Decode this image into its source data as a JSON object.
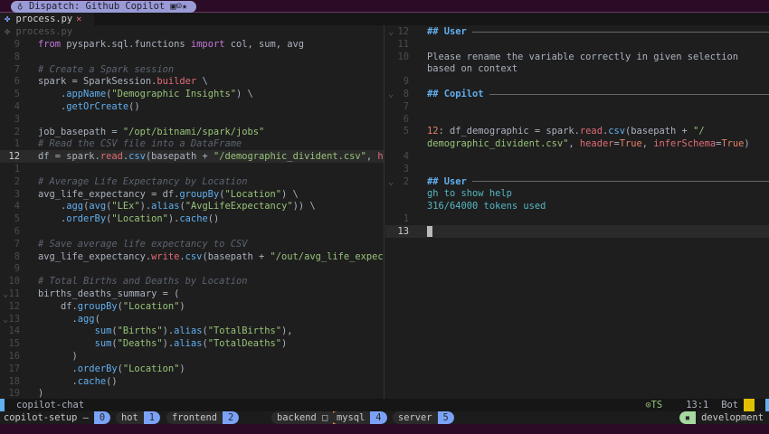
{
  "title_bar": {
    "title": "Dispatch: Github Copilot",
    "icons": [
      "tux-icon",
      "emoji-icons"
    ]
  },
  "tab": {
    "label": "process.py",
    "close": "✕"
  },
  "left_pane": {
    "winbar": "process.py",
    "lines": [
      {
        "n": "9",
        "t": [
          [
            "from ",
            "kw"
          ],
          [
            "pyspark.sql.functions ",
            ""
          ],
          [
            "import ",
            "kw"
          ],
          [
            "col, sum, avg",
            ""
          ]
        ]
      },
      {
        "n": "8",
        "t": []
      },
      {
        "n": "7",
        "t": [
          [
            "# Create a Spark session",
            "cm"
          ]
        ]
      },
      {
        "n": "6",
        "t": [
          [
            "spark = ",
            ""
          ],
          [
            "SparkSession",
            ""
          ],
          [
            ".",
            ""
          ],
          [
            "builder",
            "rd"
          ],
          [
            " \\",
            ""
          ]
        ]
      },
      {
        "n": "5",
        "t": [
          [
            "    .",
            ""
          ],
          [
            "appName",
            "fn"
          ],
          [
            "(",
            ""
          ],
          [
            "\"Demographic Insights\"",
            "st"
          ],
          [
            ") \\",
            ""
          ]
        ]
      },
      {
        "n": "4",
        "t": [
          [
            "    .",
            ""
          ],
          [
            "getOrCreate",
            "fn"
          ],
          [
            "()",
            ""
          ]
        ]
      },
      {
        "n": "3",
        "t": []
      },
      {
        "n": "2",
        "t": [
          [
            "job_basepath = ",
            ""
          ],
          [
            "\"/opt/bitnami/spark/jobs\"",
            "st"
          ]
        ]
      },
      {
        "n": "1",
        "t": [
          [
            "# Read the CSV file into a DataFrame",
            "cm"
          ]
        ]
      },
      {
        "n": "12",
        "cur": true,
        "t": [
          [
            "df = spark.",
            ""
          ],
          [
            "read",
            "rd"
          ],
          [
            ".",
            ""
          ],
          [
            "csv",
            "fn"
          ],
          [
            "(basepath + ",
            ""
          ],
          [
            "\"/demographic_divident.csv\"",
            "st"
          ],
          [
            ", ",
            ""
          ],
          [
            "h",
            "rd"
          ]
        ]
      },
      {
        "n": "1",
        "t": []
      },
      {
        "n": "2",
        "t": [
          [
            "# Average Life Expectancy by Location",
            "cm"
          ]
        ]
      },
      {
        "n": "3",
        "t": [
          [
            "avg_life_expectancy = df.",
            ""
          ],
          [
            "groupBy",
            "fn"
          ],
          [
            "(",
            ""
          ],
          [
            "\"Location\"",
            "st"
          ],
          [
            ") \\",
            ""
          ]
        ]
      },
      {
        "n": "4",
        "t": [
          [
            "    .",
            ""
          ],
          [
            "agg",
            "fn"
          ],
          [
            "(",
            ""
          ],
          [
            "avg",
            "fn"
          ],
          [
            "(",
            ""
          ],
          [
            "\"LEx\"",
            "st"
          ],
          [
            ").",
            ""
          ],
          [
            "alias",
            "fn"
          ],
          [
            "(",
            ""
          ],
          [
            "\"AvgLifeExpectancy\"",
            "st"
          ],
          [
            ")) \\",
            ""
          ]
        ]
      },
      {
        "n": "5",
        "t": [
          [
            "    .",
            ""
          ],
          [
            "orderBy",
            "fn"
          ],
          [
            "(",
            ""
          ],
          [
            "\"Location\"",
            "st"
          ],
          [
            ").",
            ""
          ],
          [
            "cache",
            "fn"
          ],
          [
            "()",
            ""
          ]
        ]
      },
      {
        "n": "6",
        "t": []
      },
      {
        "n": "7",
        "t": [
          [
            "# Save average life expectancy to CSV",
            "cm"
          ]
        ]
      },
      {
        "n": "8",
        "t": [
          [
            "avg_life_expectancy.",
            ""
          ],
          [
            "write",
            "rd"
          ],
          [
            ".",
            ""
          ],
          [
            "csv",
            "fn"
          ],
          [
            "(basepath + ",
            ""
          ],
          [
            "\"/out/avg_life_expec",
            "st"
          ]
        ]
      },
      {
        "n": "9",
        "t": []
      },
      {
        "n": "10",
        "t": [
          [
            "# Total Births and Deaths by Location",
            "cm"
          ]
        ]
      },
      {
        "n": "11",
        "fold": true,
        "t": [
          [
            "births_deaths_summary = (",
            ""
          ]
        ]
      },
      {
        "n": "12",
        "t": [
          [
            "    df.",
            ""
          ],
          [
            "groupBy",
            "fn"
          ],
          [
            "(",
            ""
          ],
          [
            "\"Location\"",
            "st"
          ],
          [
            ")",
            ""
          ]
        ]
      },
      {
        "n": "13",
        "fold": true,
        "t": [
          [
            "      .",
            ""
          ],
          [
            "agg",
            "fn"
          ],
          [
            "(",
            ""
          ]
        ]
      },
      {
        "n": "14",
        "t": [
          [
            "          ",
            ""
          ],
          [
            "sum",
            "fn"
          ],
          [
            "(",
            ""
          ],
          [
            "\"Births\"",
            "st"
          ],
          [
            ").",
            ""
          ],
          [
            "alias",
            "fn"
          ],
          [
            "(",
            ""
          ],
          [
            "\"TotalBirths\"",
            "st"
          ],
          [
            "),",
            ""
          ]
        ]
      },
      {
        "n": "15",
        "t": [
          [
            "          ",
            ""
          ],
          [
            "sum",
            "fn"
          ],
          [
            "(",
            ""
          ],
          [
            "\"Deaths\"",
            "st"
          ],
          [
            ").",
            ""
          ],
          [
            "alias",
            "fn"
          ],
          [
            "(",
            ""
          ],
          [
            "\"TotalDeaths\"",
            "st"
          ],
          [
            ")",
            ""
          ]
        ]
      },
      {
        "n": "16",
        "t": [
          [
            "      )",
            ""
          ]
        ]
      },
      {
        "n": "17",
        "t": [
          [
            "      .",
            ""
          ],
          [
            "orderBy",
            "fn"
          ],
          [
            "(",
            ""
          ],
          [
            "\"Location\"",
            "st"
          ],
          [
            ")",
            ""
          ]
        ]
      },
      {
        "n": "18",
        "t": [
          [
            "      .",
            ""
          ],
          [
            "cache",
            "fn"
          ],
          [
            "()",
            ""
          ]
        ]
      },
      {
        "n": "19",
        "t": [
          [
            ")",
            ""
          ]
        ]
      }
    ]
  },
  "right_pane": {
    "lines": [
      {
        "n": "12",
        "fold": true,
        "rule": true,
        "t": [
          [
            "## User",
            "hd"
          ]
        ]
      },
      {
        "n": "11",
        "t": []
      },
      {
        "n": "10",
        "t": [
          [
            "Please rename the variable correctly in given selection",
            ""
          ]
        ]
      },
      {
        "n": "",
        "t": [
          [
            "based on context",
            ""
          ]
        ]
      },
      {
        "n": "9",
        "t": []
      },
      {
        "n": "8",
        "fold": true,
        "rule": true,
        "t": [
          [
            "## Copilot",
            "hd"
          ]
        ]
      },
      {
        "n": "7",
        "t": []
      },
      {
        "n": "6",
        "t": []
      },
      {
        "n": "5",
        "t": [
          [
            "12",
            "or"
          ],
          [
            ": df_demographic = spark.",
            ""
          ],
          [
            "read",
            "rd"
          ],
          [
            ".",
            ""
          ],
          [
            "csv",
            "fn"
          ],
          [
            "(basepath + ",
            ""
          ],
          [
            "\"/",
            "st"
          ]
        ]
      },
      {
        "n": "",
        "t": [
          [
            "demographic_divident.csv\"",
            "st"
          ],
          [
            ", ",
            ""
          ],
          [
            "header",
            "rd"
          ],
          [
            "=",
            ""
          ],
          [
            "True",
            "or"
          ],
          [
            ", ",
            ""
          ],
          [
            "inferSchema",
            "rd"
          ],
          [
            "=",
            ""
          ],
          [
            "True",
            "or"
          ],
          [
            ")",
            ""
          ]
        ]
      },
      {
        "n": "4",
        "t": []
      },
      {
        "n": "3",
        "t": []
      },
      {
        "n": "2",
        "fold": true,
        "rule": true,
        "t": [
          [
            "## User",
            "hd"
          ]
        ]
      },
      {
        "n": "",
        "t": [
          [
            "gh to show help",
            "vt"
          ]
        ]
      },
      {
        "n": "",
        "t": [
          [
            "316/64000 tokens used",
            "vt"
          ]
        ]
      },
      {
        "n": "1",
        "t": []
      },
      {
        "n": "13",
        "cur": true,
        "cursor": true,
        "t": []
      }
    ]
  },
  "statusline": {
    "filename": "copilot-chat",
    "lsp": "TS",
    "position": "13:1",
    "scroll": "Bot"
  },
  "tmux": {
    "session": "copilot-setup",
    "windows": [
      {
        "name": "hot",
        "index": "1"
      },
      {
        "name": "frontend",
        "index": "2"
      },
      {
        "name": "backend",
        "index": "3",
        "active": true,
        "flag": "□"
      },
      {
        "name": "mysql",
        "index": "4"
      },
      {
        "name": "server",
        "index": "5"
      }
    ],
    "session_index": "0",
    "session_flag": "—",
    "right": "development"
  },
  "colors": {
    "accent": "#61afef",
    "active_window": "#f0874a",
    "window_index": "#7aa2f7",
    "title_pill": "#9a9bd6",
    "bar": "#2b0b25"
  }
}
